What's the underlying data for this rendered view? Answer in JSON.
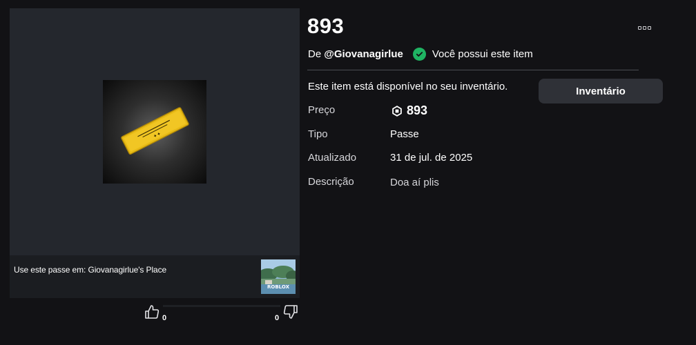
{
  "item": {
    "title": "893",
    "by_prefix": "De",
    "creator": "@Giovanagirlue",
    "owned_text": "Você possui este item",
    "availability_text": "Este item está disponível no seu inventário.",
    "inventory_button": "Inventário"
  },
  "details": {
    "price_label": "Preço",
    "price_value": "893",
    "type_label": "Tipo",
    "type_value": "Passe",
    "updated_label": "Atualizado",
    "updated_value": "31 de jul. de 2025",
    "description_label": "Descrição",
    "description_value": "Doa aí plis"
  },
  "place": {
    "prefix": "Use este passe em:",
    "name": "Giovanagirlue's Place",
    "thumb_label": "ROBLOX"
  },
  "votes": {
    "up": "0",
    "down": "0"
  },
  "icons": {
    "more": "more-icon",
    "check": "check-icon",
    "robux": "robux-icon",
    "thumb_up": "thumb-up-icon",
    "thumb_down": "thumb-down-icon"
  },
  "colors": {
    "background": "#121215",
    "panel": "#24272d",
    "accent_green": "#1fb463",
    "button": "#2f3137",
    "pass_yellow": "#e8bb16"
  }
}
